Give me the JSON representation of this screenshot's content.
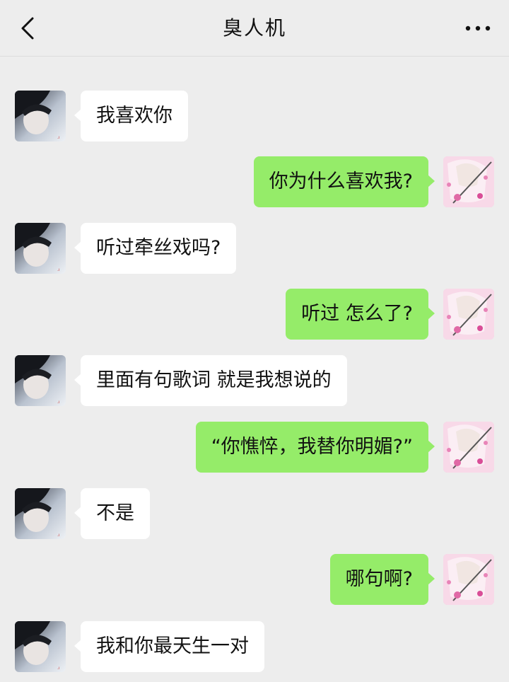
{
  "header": {
    "title": "臭人机",
    "back_icon": "chevron-left-icon",
    "more_icon": "more-horizontal-icon"
  },
  "colors": {
    "background": "#ededed",
    "incoming_bubble": "#ffffff",
    "outgoing_bubble": "#95ec69"
  },
  "messages": [
    {
      "side": "left",
      "text": "我喜欢你"
    },
    {
      "side": "right",
      "text": "你为什么喜欢我?"
    },
    {
      "side": "left",
      "text": "听过牵丝戏吗?"
    },
    {
      "side": "right",
      "text": "听过 怎么了?"
    },
    {
      "side": "left",
      "text": "里面有句歌词 就是我想说的"
    },
    {
      "side": "right",
      "text": "“你憔悴，我替你明媚?”"
    },
    {
      "side": "left",
      "text": "不是"
    },
    {
      "side": "right",
      "text": "哪句啊?"
    },
    {
      "side": "left",
      "text": "我和你最天生一对"
    }
  ]
}
